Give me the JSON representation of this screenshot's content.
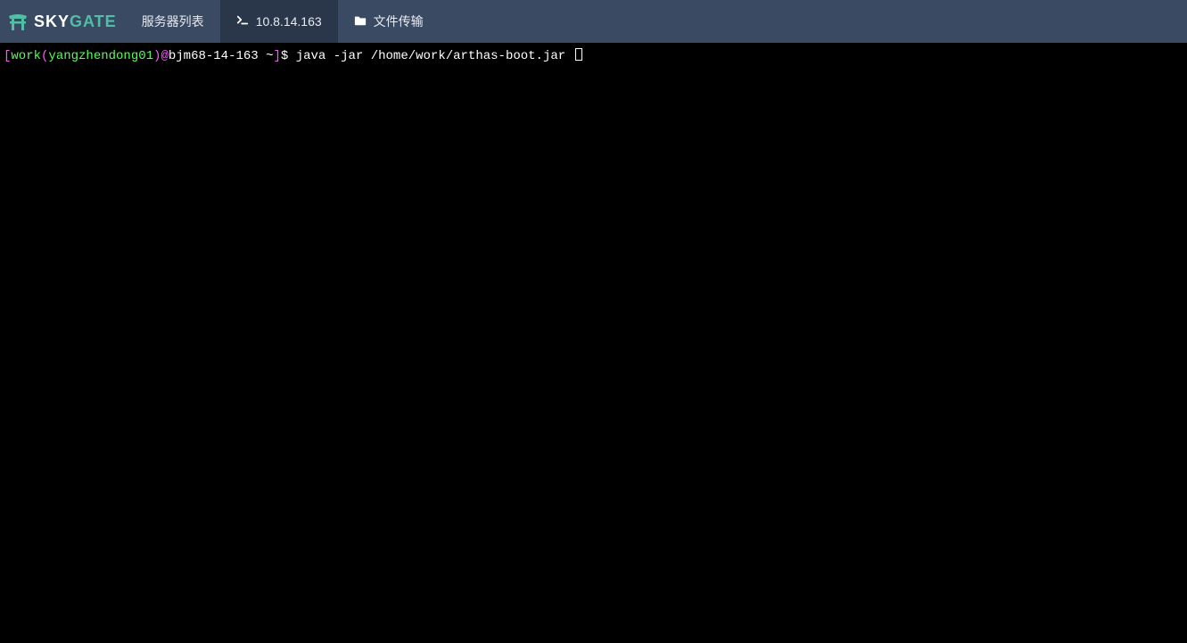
{
  "brand": {
    "sky": "SKY",
    "gate": "GATE"
  },
  "nav": {
    "serverList": "服务器列表",
    "tab_terminal_label": "10.8.14.163",
    "fileTransfer": "文件传输"
  },
  "terminal": {
    "bracket_open": "[",
    "user": "work",
    "paren_open": "(",
    "subuser": "yangzhendong01",
    "paren_close": ")",
    "at": "@",
    "host": "bjm68-14-163 ~",
    "bracket_close": "]",
    "dollar": "$ ",
    "command": "java -jar /home/work/arthas-boot.jar "
  }
}
